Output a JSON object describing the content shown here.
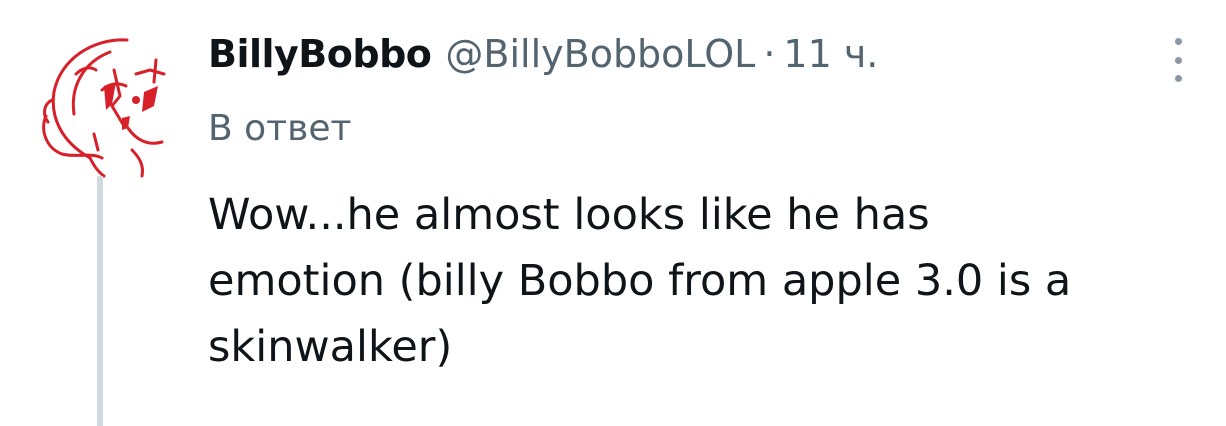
{
  "tweet": {
    "display_name": "BillyBobbo",
    "handle": "@BillyBobboLOL",
    "separator": "·",
    "time": "11 ч.",
    "reply_label": "В ответ",
    "text_lines": [
      "Wow...he almost looks like he has",
      "emotion (billy Bobbo from apple 3.0 is a",
      "skinwalker)"
    ]
  },
  "icons": {
    "avatar": "red-sketch-avatar",
    "more": "more-vertical-icon"
  },
  "colors": {
    "text_primary": "#0f1419",
    "text_secondary": "#536471",
    "thread_line": "#cfd9de",
    "avatar_red": "#d8202a"
  }
}
